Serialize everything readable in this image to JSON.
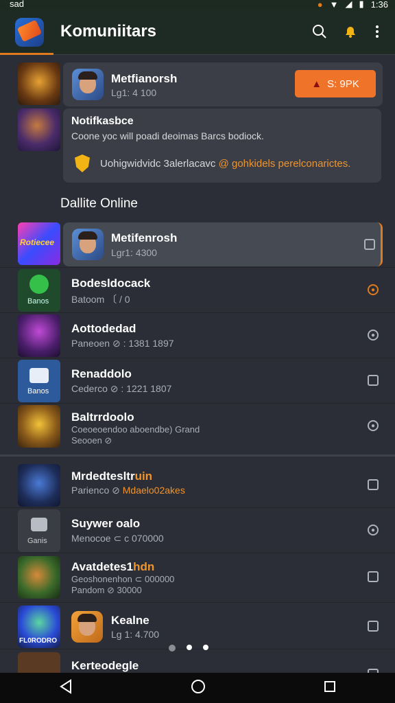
{
  "status": {
    "left": "sad",
    "time": "1:36"
  },
  "app": {
    "title": "Komuniitars"
  },
  "top_card": {
    "name": "Metfianorsh",
    "sub": "Lg1: 4 100",
    "button": "S: 9PK"
  },
  "notice": {
    "title": "Notifkasbce",
    "line1": "Coone yoc will poadi deoimas Barcs bodiock.",
    "line2a": "Uohigwidvidc 3alerlacavc ",
    "line2b": "@ gohkidels perelconarictes."
  },
  "section_title": "Dallite Online",
  "friends": [
    {
      "name": "Metifenrosh",
      "sub": "Lgr1: 4300",
      "thumb_label": "Rotiecee"
    },
    {
      "name": "Bodesldocack",
      "sub": "Batoom 〔 / 0",
      "thumb_label": "Banos"
    },
    {
      "name": "Aottodedad",
      "sub": "Paneoen ⊘ : 1381 1897"
    },
    {
      "name": "Renaddolo",
      "sub": "Cederco ⊘ : 1221 1807",
      "thumb_label": "Banos"
    },
    {
      "name": "Baltrrdoolo",
      "sub1": "Coeoeoendoo aboendbe) Grand",
      "sub2": "Seooen ⊘"
    }
  ],
  "others": [
    {
      "name": "Mrdedtesltr",
      "name_hl": "uin",
      "sub": "Parienco ⊘ ",
      "sub_hl": "Mdaelo02akes"
    },
    {
      "name": "Suywer oalo",
      "sub": "Menocoe ⊂ c 070000",
      "thumb_label": "Ganis"
    },
    {
      "name": "Avatdetes1",
      "name_hl": "hdn",
      "sub1": "Geoshonenhon ⊂ 000000",
      "sub2": "Pandom ⊘ 30000"
    },
    {
      "name": "Kealne",
      "sub": "Lg 1: 4.700",
      "thumb_label": "FL0RODRO"
    },
    {
      "name": "Kerteodegle",
      "sub": ""
    }
  ],
  "colors": {
    "accent": "#e07b1e",
    "card": "#3b3e46",
    "bg": "#2b2e36"
  }
}
